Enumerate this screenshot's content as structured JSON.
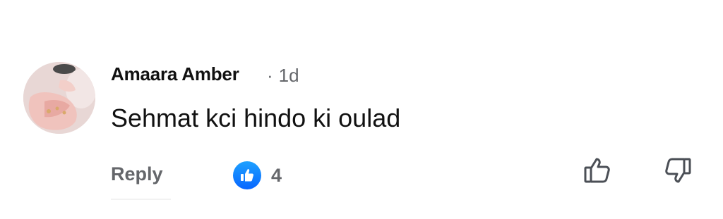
{
  "comment": {
    "author": "Amaara Amber",
    "separator": "·",
    "time": "1d",
    "text": "Sehmat kci hindo ki oulad",
    "reply_label": "Reply",
    "reaction_count": "4",
    "reaction_icon": "like-icon",
    "vote_up_icon": "thumb-up-icon",
    "vote_down_icon": "thumb-down-icon"
  },
  "colors": {
    "accent": "#0866ff",
    "secondary_text": "#65676b",
    "primary_text": "#111111"
  }
}
